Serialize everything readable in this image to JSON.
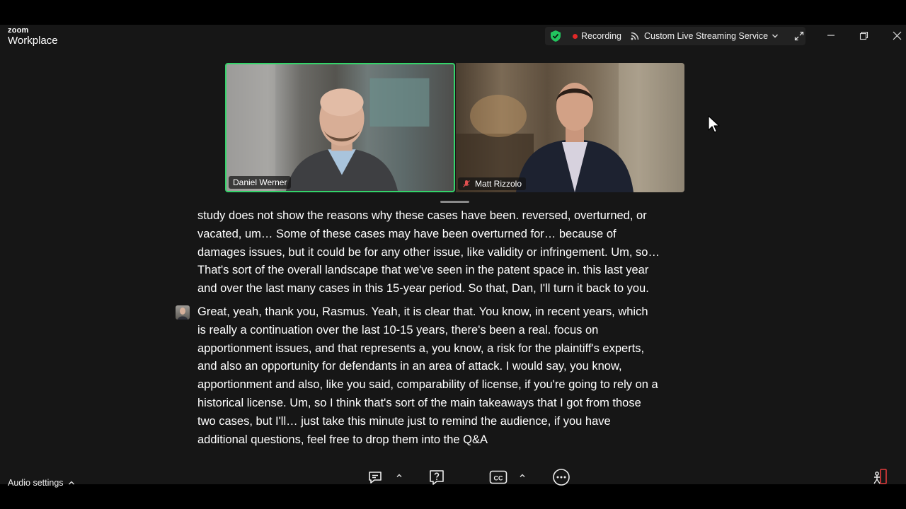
{
  "app": {
    "brand": "zoom",
    "product": "Workplace"
  },
  "status": {
    "recording_label": "Recording",
    "stream_label": "Custom Live Streaming Service",
    "shield_color": "#22c55e",
    "recording_color": "#e02828"
  },
  "participants": [
    {
      "name": "Daniel Werner",
      "active_speaker": true,
      "muted": false
    },
    {
      "name": "Matt Rizzolo",
      "active_speaker": false,
      "muted": true
    }
  ],
  "transcript": {
    "para1_lines": [
      "study does not show the reasons why these cases have been. reversed, overturned, or",
      "vacated, um… Some of these cases may have been overturned for… because of",
      "damages issues, but it could be for any other issue, like validity or infringement. Um, so…",
      "That's sort of the overall landscape that we've seen in the patent space in. this last year",
      "and over the last many cases in this 15-year period. So that, Dan, I'll turn it back to you."
    ],
    "para2_lines": [
      "Great, yeah, thank you, Rasmus. Yeah, it is clear that. You know, in recent years, which",
      "is really a continuation over the last 10-15 years, there's been a real. focus on",
      "apportionment issues, and that represents a, you know, a risk for the plaintiff's experts,",
      "and also an opportunity for defendants in an area of attack. I would say, you know,",
      "apportionment and also, like you said, comparability of license, if you're going to rely on a",
      "historical license. Um, so I think that's sort of the main takeaways that I got from those",
      "two cases, but I'll… just take this minute just to remind the audience, if you have",
      "additional questions, feel free to drop them into the Q&A"
    ]
  },
  "toolbar": {
    "audio_settings_label": "Audio settings",
    "icons": [
      "chat-icon",
      "question-icon",
      "closed-caption-icon",
      "more-icon",
      "apps-icon"
    ],
    "cc_label": "CC"
  }
}
